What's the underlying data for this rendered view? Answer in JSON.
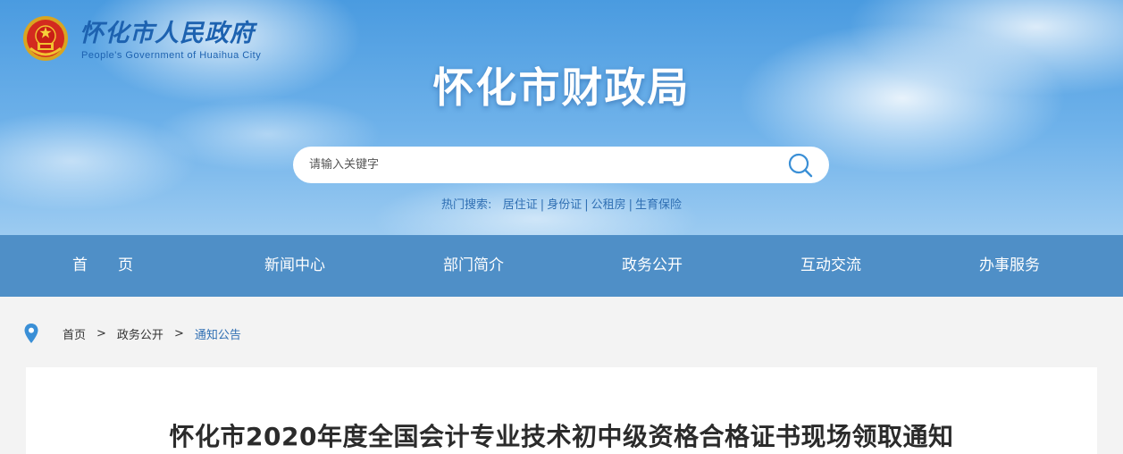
{
  "header": {
    "gov_name": "怀化市人民政府",
    "gov_name_en": "People's Government of Huaihua City",
    "emblem_icon": "national-emblem-icon",
    "site_title": "怀化市财政局"
  },
  "search": {
    "placeholder": "请输入关键字",
    "button_icon": "search-icon",
    "hot_label": "热门搜索:",
    "hot_links": [
      "居住证",
      "身份证",
      "公租房",
      "生育保险"
    ]
  },
  "nav": {
    "items": [
      "首　　页",
      "新闻中心",
      "部门简介",
      "政务公开",
      "互动交流",
      "办事服务"
    ]
  },
  "breadcrumb": {
    "icon": "location-pin-icon",
    "items": [
      "首页",
      "政务公开",
      "通知公告"
    ],
    "separator": ">"
  },
  "article": {
    "title": "怀化市2020年度全国会计专业技术初中级资格合格证书现场领取通知"
  },
  "colors": {
    "nav_bg": "#4f8fc7",
    "accent_blue": "#2f6fb3",
    "page_bg": "#f3f3f3"
  }
}
